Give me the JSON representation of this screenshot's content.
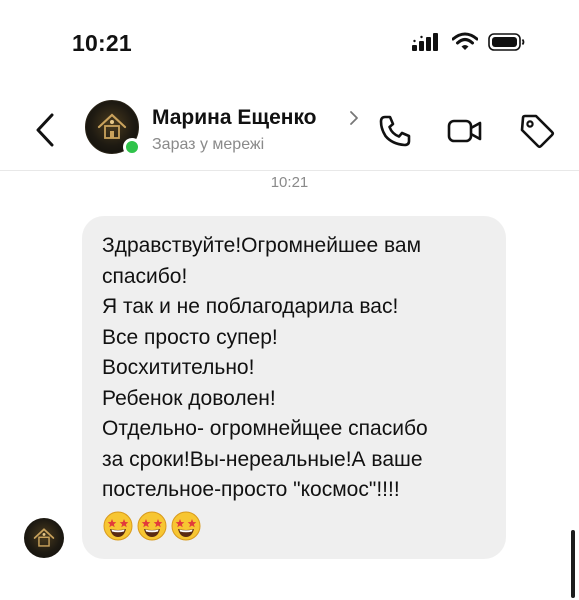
{
  "status_bar": {
    "time": "10:21"
  },
  "header": {
    "contact_name": "Марина Ещенко",
    "contact_status": "Зараз у мережі"
  },
  "conversation": {
    "timestamp": "10:21",
    "message": {
      "lines": [
        "Здравствуйте!Огромнейшее вам",
        "спасибо!",
        "Я так и не поблагодарила вас!",
        "Все просто супер!",
        "Восхитительно!",
        "Ребенок доволен!",
        "Отдельно- огромнейщее спасибо",
        "за сроки!Вы-нереальные!А ваше",
        "постельное-просто \"космос\"!!!!"
      ],
      "emoji": [
        "star-struck-emoji",
        "star-struck-emoji",
        "star-struck-emoji"
      ]
    }
  },
  "colors": {
    "online": "#2fc34a",
    "bubble": "#efefef",
    "secondary_text": "#8a8a8a"
  }
}
